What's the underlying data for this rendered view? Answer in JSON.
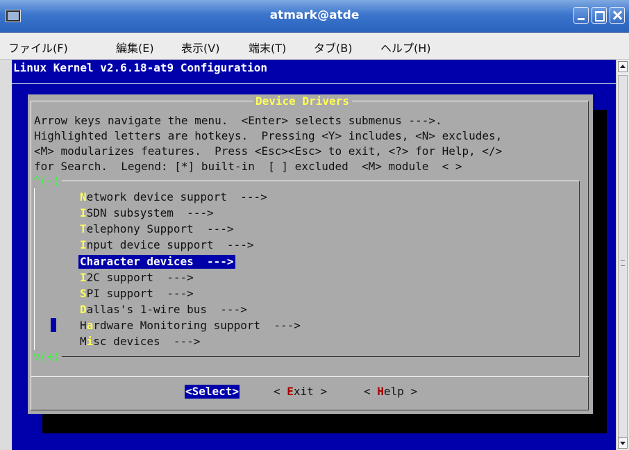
{
  "window": {
    "title": "atmark@atde"
  },
  "menubar": [
    "ファイル(F)",
    "編集(E)",
    "表示(V)",
    "端末(T)",
    "タブ(B)",
    "ヘルプ(H)"
  ],
  "terminal": {
    "header": "Linux Kernel v2.6.18-at9 Configuration",
    "dialog_title": "Device Drivers",
    "help_lines": [
      "Arrow keys navigate the menu.  <Enter> selects submenus --->.",
      "Highlighted letters are hotkeys.  Pressing <Y> includes, <N> excludes,",
      "<M> modularizes features.  Press <Esc><Esc> to exit, <?> for Help, </>",
      "for Search.  Legend: [*] built-in  [ ] excluded  <M> module  < >"
    ],
    "scroll_up": "^(-)",
    "scroll_down": "v(+)",
    "items": [
      {
        "hotkey": "N",
        "rest": "etwork device support  --->"
      },
      {
        "hotkey": "I",
        "rest": "SDN subsystem  --->"
      },
      {
        "hotkey": "T",
        "rest": "elephony Support  --->"
      },
      {
        "hotkey": "I",
        "rest": "nput device support  --->"
      },
      {
        "hotkey": "C",
        "rest": "haracter devices  --->"
      },
      {
        "hotkey": "I",
        "rest": "2C support  --->"
      },
      {
        "hotkey": "S",
        "rest": "PI support  --->"
      },
      {
        "hotkey": "D",
        "rest": "allas's 1-wire bus  --->"
      },
      {
        "pre": "H",
        "hotkey": "a",
        "rest": "rdware Monitoring support  --->"
      },
      {
        "pre": "M",
        "hotkey": "i",
        "rest": "sc devices  --->"
      }
    ],
    "selected_index": 4,
    "buttons": {
      "select": "<Select>",
      "exit_open": "< ",
      "exit_hot": "E",
      "exit_rest": "xit >",
      "help_open": "< ",
      "help_hot": "H",
      "help_rest": "elp >"
    }
  }
}
